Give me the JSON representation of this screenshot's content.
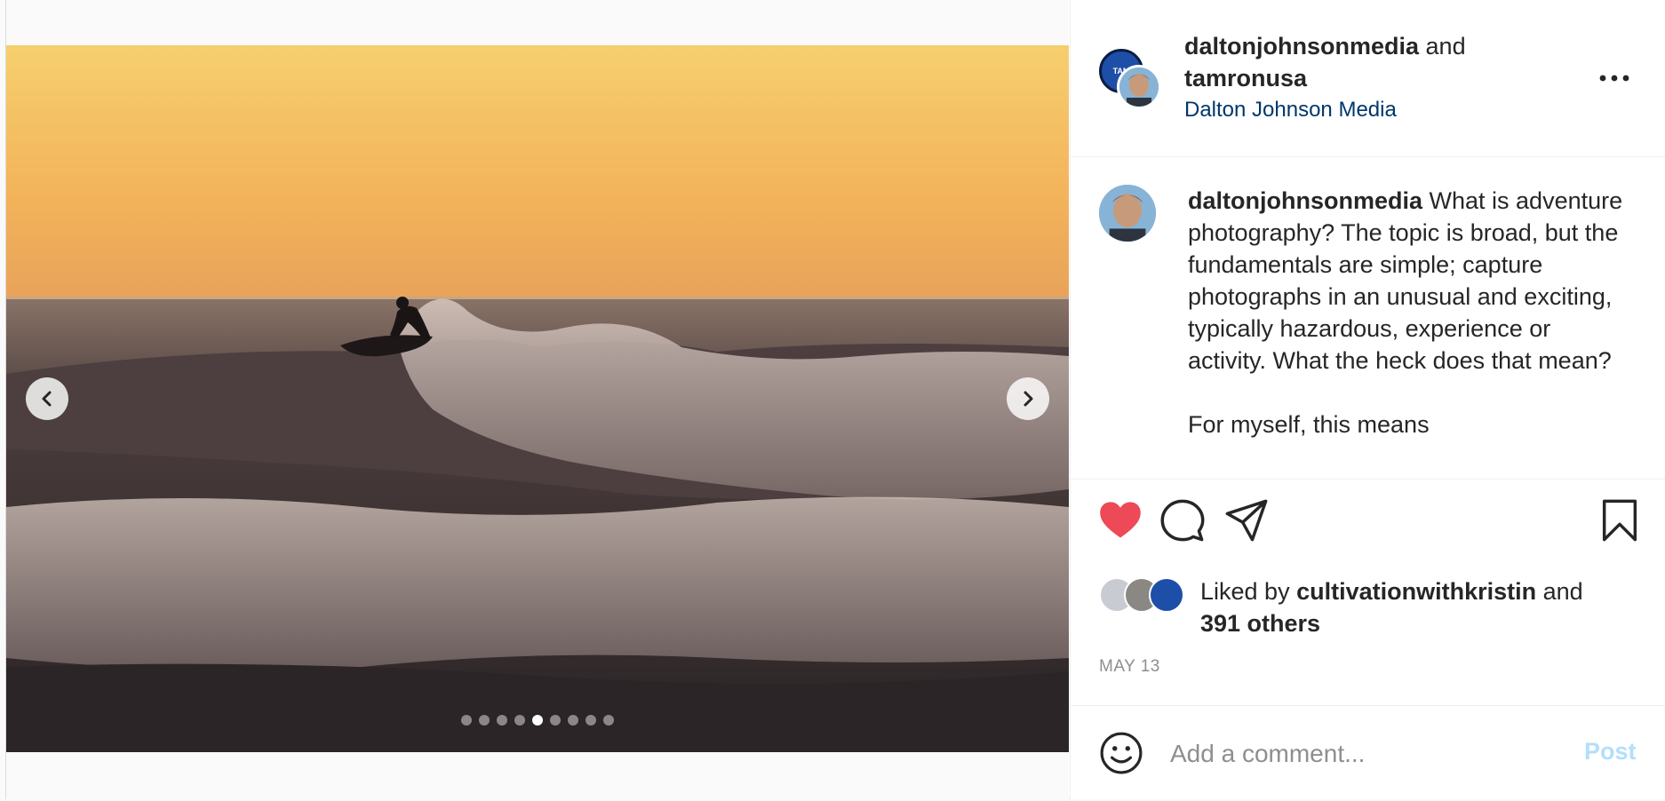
{
  "media": {
    "carousel_count": 9,
    "active_index": 4,
    "prev_icon": "chevron-left-icon",
    "next_icon": "chevron-right-icon"
  },
  "header": {
    "owner": "daltonjohnsonmedia",
    "joiner": "and",
    "collaborator": "tamronusa",
    "subtitle": "Dalton Johnson Media",
    "collab_avatar_text": "TAM",
    "more_icon": "more-options-icon"
  },
  "caption": {
    "username": "daltonjohnsonmedia",
    "text": " What is adventure photography? The topic is broad, but the fundamentals are simple; capture photographs in an unusual and exciting, typically hazardous, experience or activity. What the heck does that mean?\n\nFor myself, this means"
  },
  "actions": {
    "like_icon": "heart-icon",
    "comment_icon": "comment-icon",
    "share_icon": "send-icon",
    "save_icon": "bookmark-icon",
    "liked": true
  },
  "likes": {
    "prefix": "Liked by",
    "first_liker": "cultivationwithkristin",
    "joiner": "and",
    "others": "391 others"
  },
  "date": "MAY 13",
  "comment": {
    "placeholder": "Add a comment...",
    "post_label": "Post",
    "emoji_icon": "emoji-icon"
  },
  "colors": {
    "like_red": "#ed4956",
    "link_blue": "#00376b",
    "post_disabled": "#b2dffc",
    "muted": "#8e8e8e"
  }
}
